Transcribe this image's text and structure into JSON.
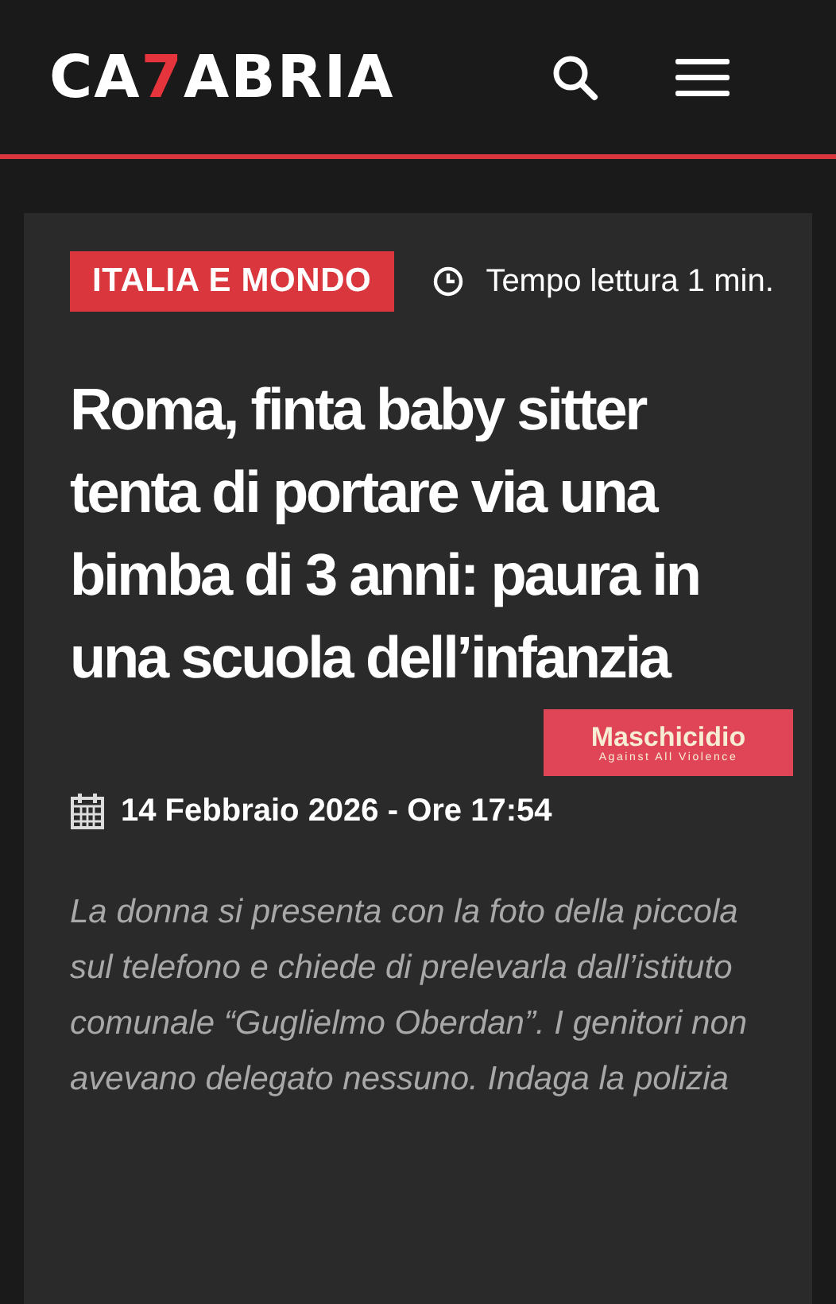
{
  "header": {
    "logo": {
      "start": "CA",
      "accent": "7",
      "end": "ABRIA"
    }
  },
  "article": {
    "category": "ITALIA E MONDO",
    "reading_time": "Tempo lettura 1 min.",
    "title": "Roma, finta baby sitter tenta di portare via una bimba di 3 anni: paura in una scuola dell’infanzia",
    "banner": {
      "title": "Maschicidio",
      "subtitle": "Against All Violence"
    },
    "date": "14 Febbraio 2026 - Ore 17:54",
    "summary": "La donna si presenta con la foto della piccola sul telefono e chiede di prelevarla dall’istituto comunale “Guglielmo Oberdan”. I genitori non avevano delegato nessuno. Indaga la polizia"
  }
}
